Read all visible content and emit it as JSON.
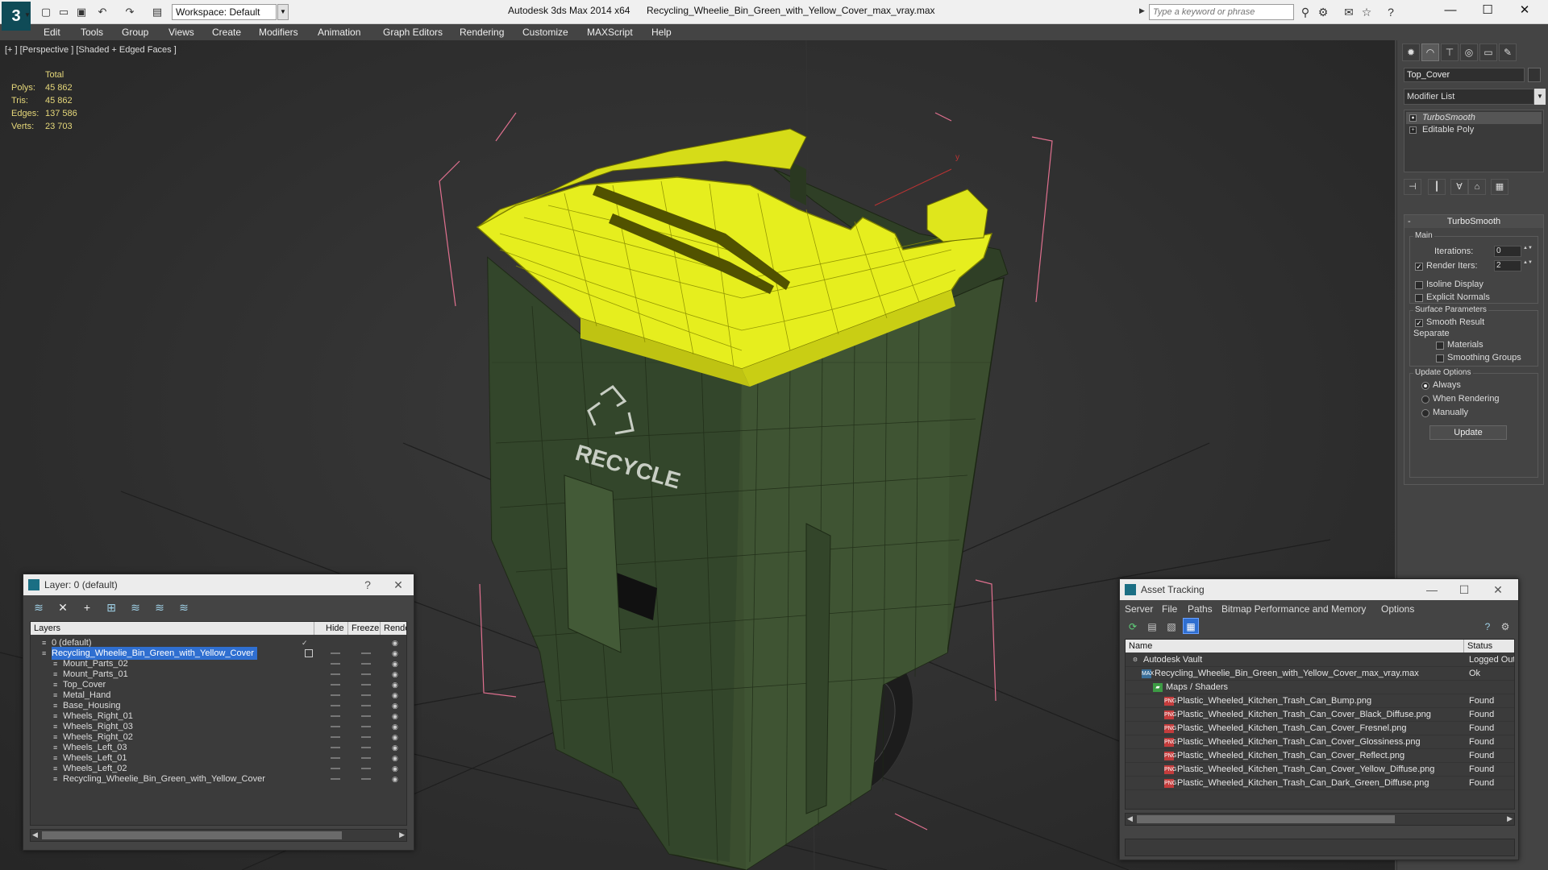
{
  "titlebar": {
    "workspace": "Workspace: Default",
    "app_title": "Autodesk 3ds Max  2014 x64",
    "file_title": "Recycling_Wheelie_Bin_Green_with_Yellow_Cover_max_vray.max",
    "search_placeholder": "Type a keyword or phrase",
    "minimize": "—",
    "maximize": "☐",
    "close": "✕"
  },
  "menu": [
    "Edit",
    "Tools",
    "Group",
    "Views",
    "Create",
    "Modifiers",
    "Animation",
    "Graph Editors",
    "Rendering",
    "Customize",
    "MAXScript",
    "Help"
  ],
  "viewport": {
    "label": "[+ ] [Perspective ] [Shaded + Edged Faces ]",
    "stats_header": "Total",
    "stats": [
      {
        "label": "Polys:",
        "value": "45 862"
      },
      {
        "label": "Tris:",
        "value": "45 862"
      },
      {
        "label": "Edges:",
        "value": "137 586"
      },
      {
        "label": "Verts:",
        "value": "23 703"
      }
    ],
    "bin_text": "RECYCLE",
    "axis_label": "y",
    "colors": {
      "bin_green": "#3b4e2f",
      "lid_yellow": "#e6ee1e",
      "bbox": "#e0708f"
    }
  },
  "command_panel": {
    "object_name": "Top_Cover",
    "modifier_list": "Modifier List",
    "stack": [
      "TurboSmooth",
      "Editable Poly"
    ],
    "rollout_title": "TurboSmooth",
    "main_group": "Main",
    "iterations_label": "Iterations:",
    "iterations_value": "0",
    "render_iters_label": "Render Iters:",
    "render_iters_value": "2",
    "isoline_label": "Isoline Display",
    "explicit_normals_label": "Explicit Normals",
    "surface_group": "Surface Parameters",
    "smooth_result_label": "Smooth Result",
    "separate_label": "Separate",
    "materials_label": "Materials",
    "smoothing_groups_label": "Smoothing Groups",
    "update_group": "Update Options",
    "always_label": "Always",
    "when_rendering_label": "When Rendering",
    "manually_label": "Manually",
    "update_button": "Update"
  },
  "layer_dialog": {
    "title": "Layer: 0 (default)",
    "help": "?",
    "close": "✕",
    "columns": [
      "Layers",
      "Hide",
      "Freeze",
      "Render"
    ],
    "rows": [
      {
        "name": "0 (default)",
        "level": 1,
        "selected": false
      },
      {
        "name": "Recycling_Wheelie_Bin_Green_with_Yellow_Cover",
        "level": 1,
        "selected": true
      },
      {
        "name": "Mount_Parts_02",
        "level": 2,
        "selected": false
      },
      {
        "name": "Mount_Parts_01",
        "level": 2,
        "selected": false
      },
      {
        "name": "Top_Cover",
        "level": 2,
        "selected": false
      },
      {
        "name": "Metal_Hand",
        "level": 2,
        "selected": false
      },
      {
        "name": "Base_Housing",
        "level": 2,
        "selected": false
      },
      {
        "name": "Wheels_Right_01",
        "level": 2,
        "selected": false
      },
      {
        "name": "Wheels_Right_03",
        "level": 2,
        "selected": false
      },
      {
        "name": "Wheels_Right_02",
        "level": 2,
        "selected": false
      },
      {
        "name": "Wheels_Left_03",
        "level": 2,
        "selected": false
      },
      {
        "name": "Wheels_Left_01",
        "level": 2,
        "selected": false
      },
      {
        "name": "Wheels_Left_02",
        "level": 2,
        "selected": false
      },
      {
        "name": "Recycling_Wheelie_Bin_Green_with_Yellow_Cover",
        "level": 2,
        "selected": false
      }
    ]
  },
  "asset_dialog": {
    "title": "Asset Tracking",
    "menu": [
      "Server",
      "File",
      "Paths",
      "Bitmap Performance and Memory",
      "Options"
    ],
    "columns": [
      "Name",
      "Status"
    ],
    "rows": [
      {
        "name": "Autodesk Vault",
        "status": "Logged Out",
        "level": 0,
        "icon": "vault"
      },
      {
        "name": "Recycling_Wheelie_Bin_Green_with_Yellow_Cover_max_vray.max",
        "status": "Ok",
        "level": 1,
        "icon": "max"
      },
      {
        "name": "Maps / Shaders",
        "status": "",
        "level": 2,
        "icon": "folder"
      },
      {
        "name": "Plastic_Wheeled_Kitchen_Trash_Can_Bump.png",
        "status": "Found",
        "level": 3,
        "icon": "png"
      },
      {
        "name": "Plastic_Wheeled_Kitchen_Trash_Can_Cover_Black_Diffuse.png",
        "status": "Found",
        "level": 3,
        "icon": "png"
      },
      {
        "name": "Plastic_Wheeled_Kitchen_Trash_Can_Cover_Fresnel.png",
        "status": "Found",
        "level": 3,
        "icon": "png"
      },
      {
        "name": "Plastic_Wheeled_Kitchen_Trash_Can_Cover_Glossiness.png",
        "status": "Found",
        "level": 3,
        "icon": "png"
      },
      {
        "name": "Plastic_Wheeled_Kitchen_Trash_Can_Cover_Reflect.png",
        "status": "Found",
        "level": 3,
        "icon": "png"
      },
      {
        "name": "Plastic_Wheeled_Kitchen_Trash_Can_Cover_Yellow_Diffuse.png",
        "status": "Found",
        "level": 3,
        "icon": "png"
      },
      {
        "name": "Plastic_Wheeled_Kitchen_Trash_Can_Dark_Green_Diffuse.png",
        "status": "Found",
        "level": 3,
        "icon": "png"
      }
    ]
  }
}
